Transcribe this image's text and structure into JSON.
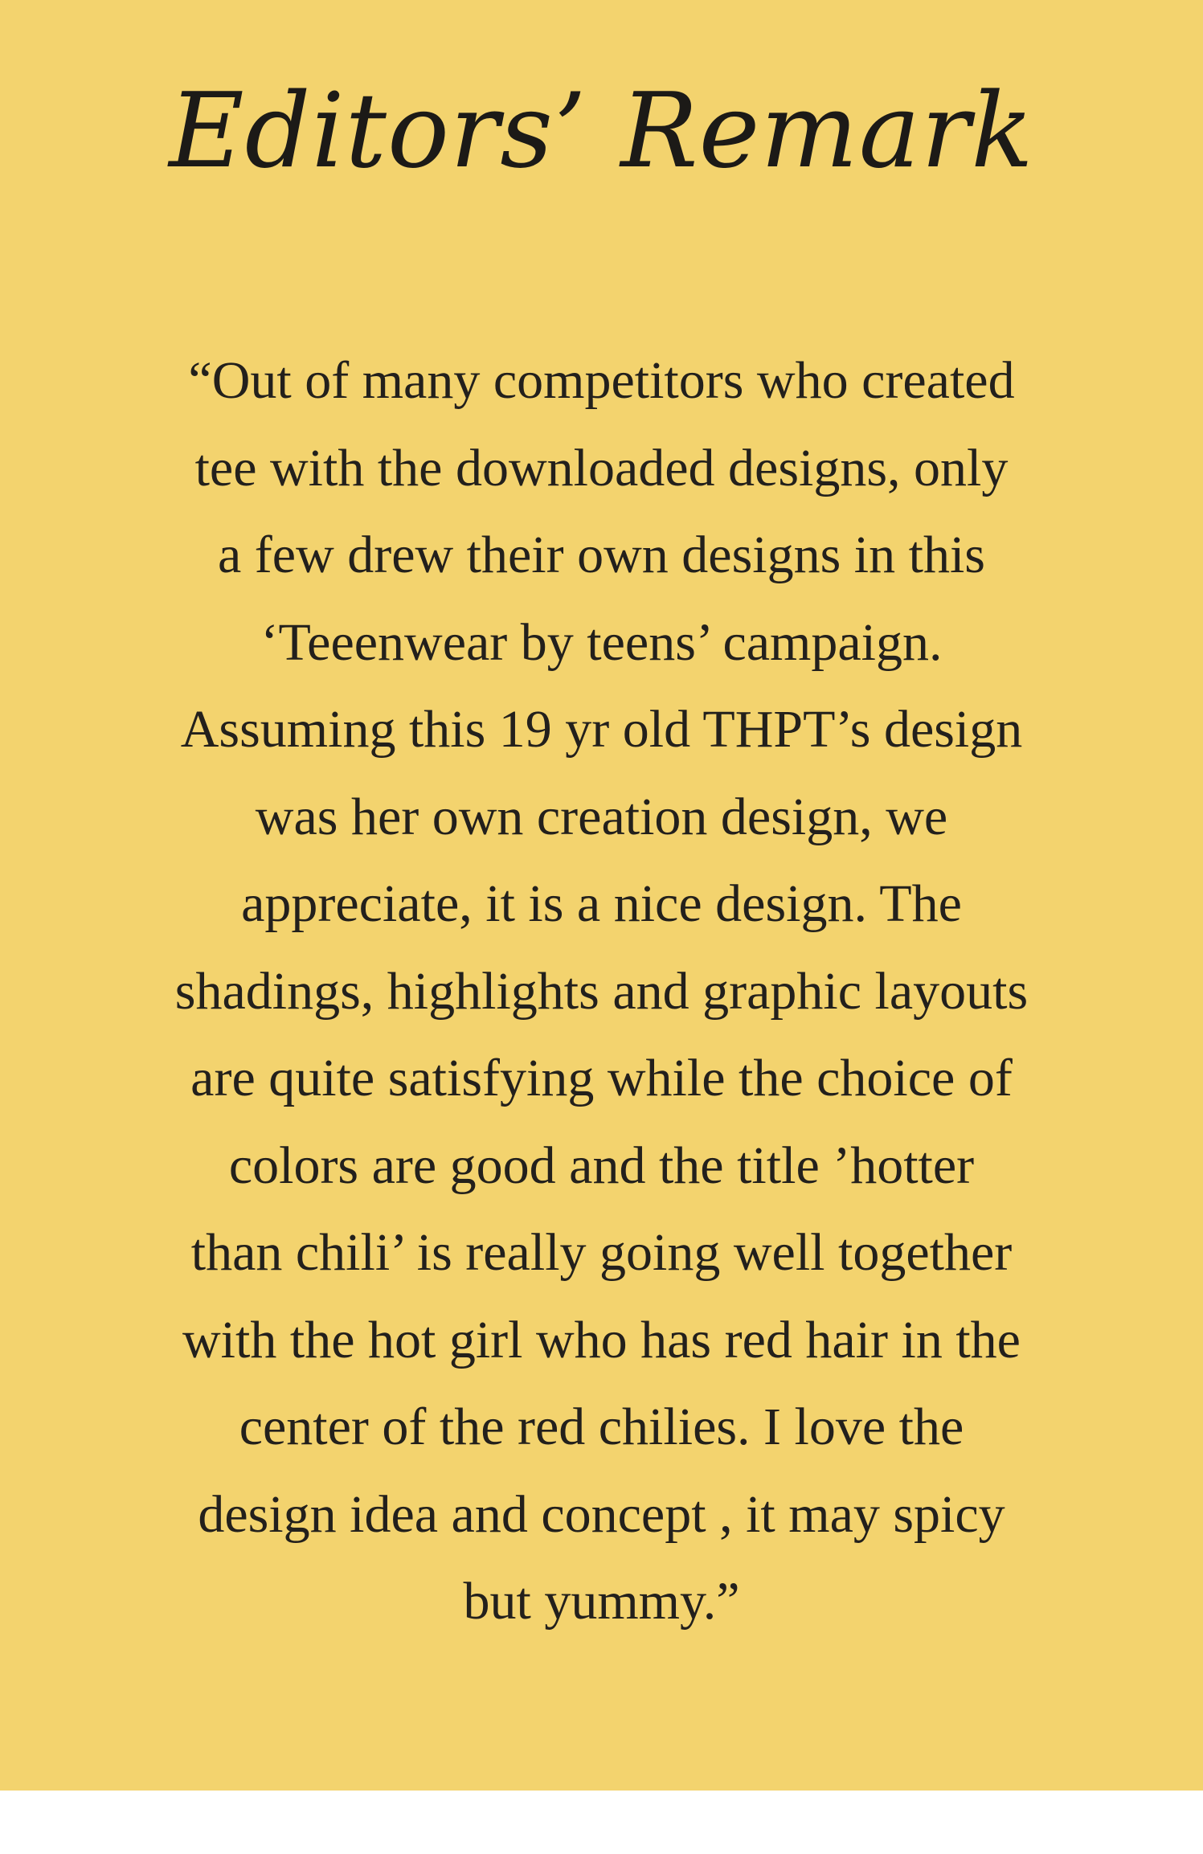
{
  "heading": {
    "title": "Editors’ Remark"
  },
  "remark": {
    "lines": [
      "“Out of many competitors who created",
      "tee with the downloaded designs, only",
      "a few drew their own designs in this",
      "‘Teeenwear by teens’ campaign.",
      "Assuming this 19 yr old THPT’s design",
      "was her own creation design, we",
      "appreciate, it is a nice design. The",
      "shadings, highlights and graphic layouts",
      "are quite satisfying while the choice of",
      "colors are good and the title ’hotter",
      "than chili’ is really going well together",
      "with the hot girl who has red hair in the",
      "center of the red chilies. I love the",
      "design idea and concept , it may spicy",
      "but yummy.”"
    ]
  },
  "colors": {
    "background": "#f3d36e",
    "text": "#23201c",
    "page_margin": "#ffffff"
  }
}
